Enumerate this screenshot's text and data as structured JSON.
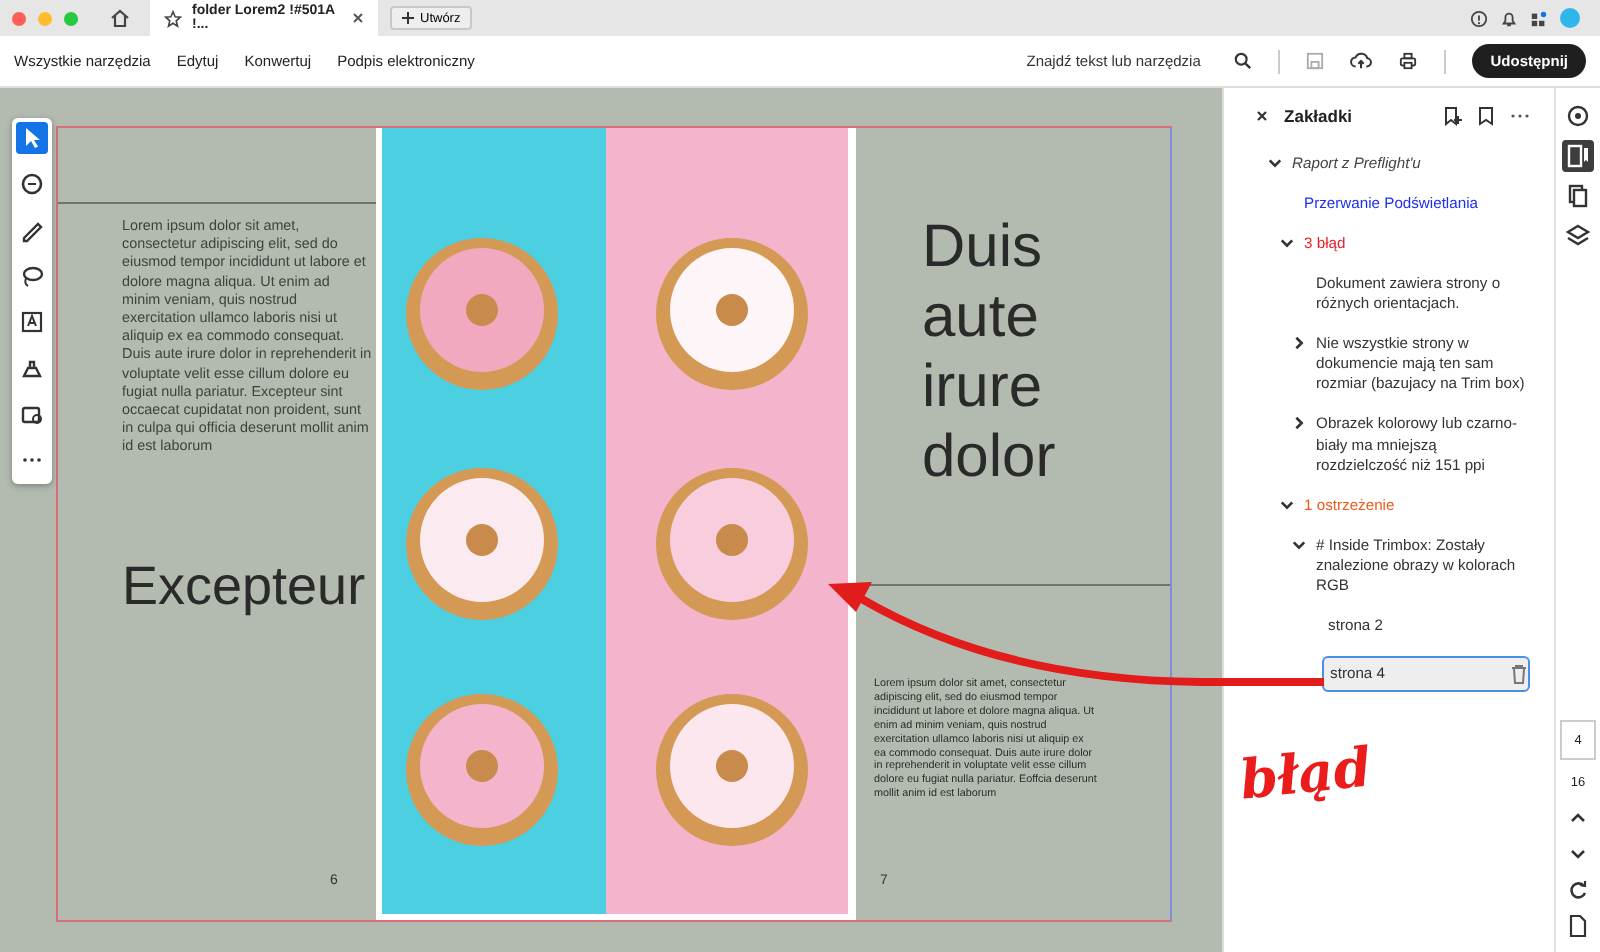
{
  "browser": {
    "tab_title": "folder Lorem2 !#501A !...",
    "new_tab_button": "Utwórz"
  },
  "menu": [
    "Wszystkie narzędzia",
    "Edytuj",
    "Konwertuj",
    "Podpis elektroniczny"
  ],
  "search": {
    "placeholder": "Znajdź tekst lub narzędzia"
  },
  "share_button": "Udostępnij",
  "tools": [
    {
      "kind": "pointer",
      "selected": true
    },
    {
      "kind": "comment",
      "selected": false
    },
    {
      "kind": "pen",
      "selected": false
    },
    {
      "kind": "lasso",
      "selected": false
    },
    {
      "kind": "text",
      "selected": false
    },
    {
      "kind": "stamp",
      "selected": false
    },
    {
      "kind": "scan",
      "selected": false
    },
    {
      "kind": "more",
      "selected": false
    }
  ],
  "document": {
    "left_page": {
      "paragraph": "Lorem ipsum dolor sit amet, consectetur adipiscing elit, sed do eiusmod tempor incididunt ut labore et dolore magna aliqua. Ut enim ad minim veniam, quis nostrud exercitation ullamco laboris nisi ut aliquip ex ea commodo consequat. Duis aute irure dolor in reprehenderit in voluptate velit esse cillum dolore eu fugiat nulla pariatur. Excepteur sint occaecat cupidatat non proident, sunt in culpa qui officia deserunt mollit anim id est laborum",
      "heading": "Excepteur",
      "page_number": "6"
    },
    "right_page": {
      "heading": "Duis aute irure dolor",
      "paragraph": "Lorem ipsum dolor sit amet, consectetur adipiscing elit, sed do eiusmod tempor incididunt ut labore et dolore magna aliqua. Ut enim ad minim veniam, quis nostrud exercitation ullamco laboris nisi ut aliquip ex ea commodo consequat. Duis aute irure dolor in reprehenderit in voluptate velit esse cillum dolore eu fugiat nulla pariatur. Eoffcia deserunt mollit anim id est laborum",
      "page_number": "7"
    }
  },
  "annotation": {
    "label": "błąd"
  },
  "panel": {
    "title": "Zakładki",
    "tree": [
      {
        "label": "Raport z Preflight'u",
        "kind": "report",
        "expanded": true,
        "selected": false,
        "children": [
          {
            "label": "Przerwanie Podświetlania",
            "kind": "link",
            "selected": false
          },
          {
            "label": "3 błąd",
            "kind": "error",
            "expanded": true,
            "selected": false,
            "children": [
              {
                "label": "Dokument zawiera strony o różnych orientacjach.",
                "kind": "item",
                "selected": false
              },
              {
                "label": "Nie wszystkie strony w dokumencie mają ten sam rozmiar (bazujacy na Trim box)",
                "kind": "item",
                "expanded": false,
                "selected": false
              },
              {
                "label": "Obrazek kolorowy lub czarno-biały ma mniejszą rozdzielczość niż 151 ppi",
                "kind": "item",
                "expanded": false,
                "selected": false
              }
            ]
          },
          {
            "label": "1 ostrzeżenie",
            "kind": "warning",
            "expanded": true,
            "selected": false,
            "children": [
              {
                "label": "# Inside Trimbox: Zostały znalezione obrazy w kolorach RGB",
                "kind": "item",
                "expanded": true,
                "selected": false,
                "children": [
                  {
                    "label": "strona 2",
                    "kind": "page",
                    "selected": false
                  },
                  {
                    "label": "strona 4",
                    "kind": "page",
                    "selected": true
                  }
                ]
              }
            ]
          }
        ]
      }
    ]
  },
  "rail": {
    "tools": [
      {
        "kind": "accessibility",
        "selected": false
      },
      {
        "kind": "bookmarks",
        "selected": true
      },
      {
        "kind": "pages",
        "selected": false
      },
      {
        "kind": "layers",
        "selected": false
      }
    ],
    "current_page": "4",
    "page_count": "16"
  }
}
